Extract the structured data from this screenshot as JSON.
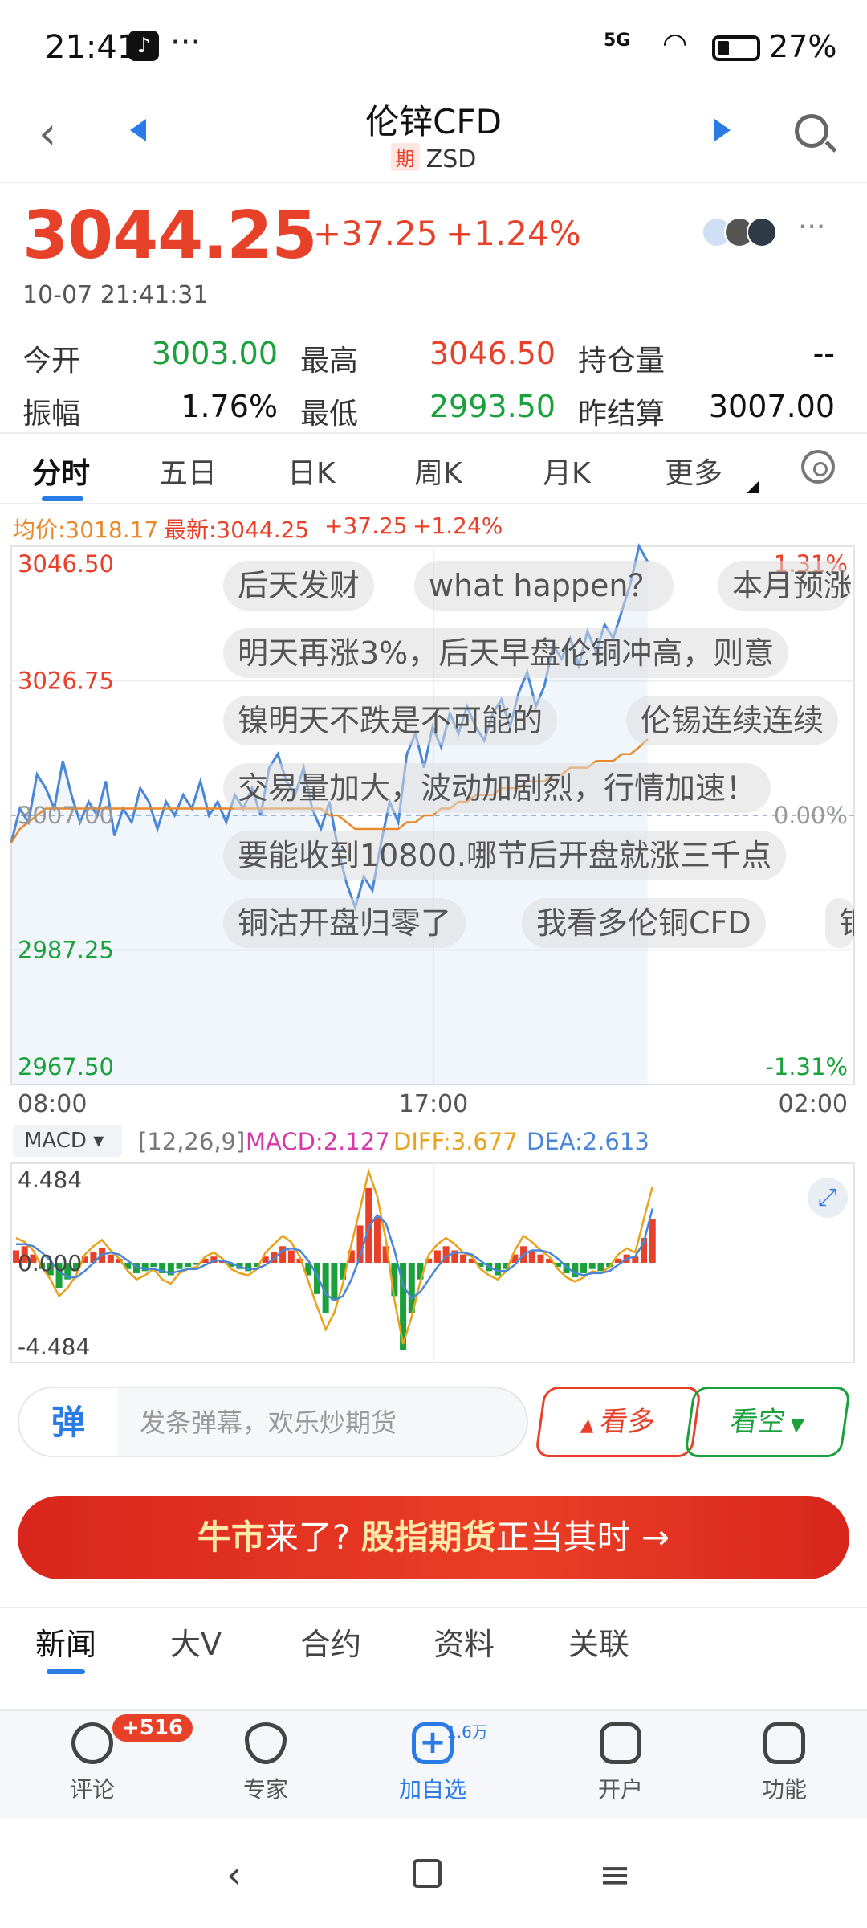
{
  "status_bar": {
    "time": "21:41",
    "more": "···",
    "signal": "5G",
    "battery": "27%"
  },
  "header": {
    "title": "伦锌CFD",
    "tag": "期",
    "code": "ZSD"
  },
  "quote": {
    "price": "3044.25",
    "change": "+37.25",
    "change_pct": "+1.24%",
    "timestamp": "10-07 21:41:31",
    "stats": [
      {
        "label": "今开",
        "value": "3003.00",
        "color": "green"
      },
      {
        "label": "最高",
        "value": "3046.50",
        "color": "red"
      },
      {
        "label": "持仓量",
        "value": "--",
        "color": "black"
      },
      {
        "label": "振幅",
        "value": "1.76%",
        "color": "black"
      },
      {
        "label": "最低",
        "value": "2993.50",
        "color": "green"
      },
      {
        "label": "昨结算",
        "value": "3007.00",
        "color": "black"
      }
    ]
  },
  "period_tabs": [
    "分时",
    "五日",
    "日K",
    "周K",
    "月K",
    "更多"
  ],
  "chart_info": {
    "avg": "均价:3018.17",
    "latest": "最新:3044.25",
    "chg": "+37.25",
    "chg_pct": "+1.24%"
  },
  "chart_data": {
    "type": "line",
    "ylim": [
      2967.5,
      3046.5
    ],
    "y_ticks_left": [
      "3046.50",
      "3026.75",
      "3007.00",
      "2987.25",
      "2967.50"
    ],
    "y_ticks_right": [
      "1.31%",
      "0.00%",
      "-1.31%"
    ],
    "x_ticks": [
      "08:00",
      "17:00",
      "02:00"
    ],
    "baseline": 3007.0,
    "series": [
      {
        "name": "最新",
        "color": "#4a86d8",
        "values": [
          3003,
          3008,
          3006,
          3013,
          3011,
          3008,
          3015,
          3010,
          3006,
          3009,
          3007,
          3012,
          3004,
          3008,
          3006,
          3011,
          3009,
          3005,
          3009,
          3007,
          3010,
          3008,
          3012,
          3007,
          3009,
          3006,
          3010,
          3008,
          3011,
          3007,
          3014,
          3016,
          3012,
          3010,
          3014,
          3008,
          3005,
          3009,
          3002,
          2997,
          2993.5,
          2998,
          2996,
          3003,
          3009,
          3006,
          3016,
          3019,
          3014,
          3020,
          3017,
          3022,
          3019,
          3023,
          3020,
          3018,
          3022,
          3024,
          3020,
          3025,
          3028,
          3023,
          3026,
          3032,
          3030,
          3033,
          3029,
          3034,
          3031,
          3035,
          3033,
          3037,
          3041,
          3046.5,
          3044.25
        ]
      },
      {
        "name": "均价",
        "color": "#e88a2c",
        "values": [
          3003,
          3005,
          3006,
          3007,
          3008,
          3008,
          3008,
          3008,
          3008,
          3008,
          3008,
          3008,
          3008,
          3008,
          3008,
          3008,
          3008,
          3008,
          3008,
          3008,
          3008,
          3008,
          3008,
          3008,
          3008,
          3008,
          3008,
          3008,
          3008,
          3008,
          3008,
          3008,
          3008,
          3008,
          3008,
          3008,
          3008,
          3007,
          3007,
          3006,
          3005,
          3005,
          3005,
          3005,
          3005,
          3005,
          3006,
          3006,
          3007,
          3007,
          3008,
          3008,
          3009,
          3009,
          3010,
          3010,
          3010,
          3011,
          3011,
          3011,
          3012,
          3012,
          3012,
          3013,
          3013,
          3014,
          3014,
          3014,
          3015,
          3015,
          3015,
          3016,
          3016,
          3017,
          3018.17
        ]
      }
    ]
  },
  "danmaku": [
    "后天发财",
    "what happen？",
    "本月预涨",
    "明天再涨3%，后天早盘伦铜冲高，则意",
    "镍明天不跌是不可能的",
    "伦锡连续连续",
    "交易量加大，波动加剧烈，行情加速！",
    "要能收到10800.哪节后开盘就涨三千点",
    "铜沽开盘归零了",
    "我看多伦铜CFD",
    "铜"
  ],
  "macd": {
    "selector": "MACD",
    "params": "[12,26,9]",
    "macd": "MACD:2.127",
    "diff": "DIFF:3.677",
    "dea": "DEA:2.613",
    "y_ticks": [
      "4.484",
      "0.000",
      "-4.484"
    ],
    "hist": [
      0.6,
      0.8,
      0.4,
      -0.3,
      -0.6,
      -1.2,
      -0.8,
      -0.4,
      0.3,
      0.5,
      0.7,
      0.4,
      0.2,
      -0.3,
      -0.5,
      -0.4,
      -0.2,
      -0.5,
      -0.6,
      -0.3,
      -0.2,
      -0.1,
      0.2,
      0.3,
      0.1,
      -0.2,
      -0.3,
      -0.4,
      -0.2,
      0.3,
      0.5,
      0.8,
      0.6,
      0.2,
      -0.6,
      -1.5,
      -2.4,
      -1.8,
      -0.8,
      0.6,
      1.8,
      3.6,
      2.2,
      0.8,
      -1.6,
      -4.2,
      -2.4,
      -0.8,
      0.2,
      0.6,
      0.8,
      0.6,
      0.4,
      0.2,
      -0.2,
      -0.4,
      -0.6,
      -0.3,
      0.4,
      0.8,
      0.6,
      0.4,
      0.2,
      -0.2,
      -0.5,
      -0.7,
      -0.5,
      -0.3,
      -0.4,
      -0.2,
      0.2,
      0.4,
      0.3,
      1.2,
      2.1
    ],
    "diff_line": [
      1.2,
      1.0,
      0.6,
      -0.2,
      -0.8,
      -1.6,
      -1.2,
      -0.6,
      0.4,
      0.8,
      1.1,
      0.6,
      0.2,
      -0.4,
      -0.8,
      -0.6,
      -0.3,
      -0.8,
      -1.0,
      -0.5,
      -0.3,
      -0.2,
      0.3,
      0.5,
      0.2,
      -0.3,
      -0.5,
      -0.6,
      -0.3,
      0.5,
      0.9,
      1.3,
      1.0,
      0.3,
      -0.9,
      -2.1,
      -3.2,
      -2.4,
      -1.0,
      0.9,
      2.6,
      4.4,
      3.2,
      1.1,
      -1.8,
      -3.9,
      -2.6,
      -0.9,
      0.4,
      0.9,
      1.2,
      0.9,
      0.5,
      0.3,
      -0.3,
      -0.6,
      -0.8,
      -0.4,
      0.6,
      1.3,
      1.0,
      0.6,
      0.3,
      -0.3,
      -0.7,
      -0.9,
      -0.7,
      -0.4,
      -0.5,
      -0.2,
      0.4,
      0.7,
      0.5,
      2.1,
      3.677
    ],
    "dea_line": [
      0.9,
      0.9,
      0.8,
      0.5,
      0.1,
      -0.4,
      -0.7,
      -0.7,
      -0.4,
      0.0,
      0.4,
      0.5,
      0.4,
      0.1,
      -0.2,
      -0.3,
      -0.3,
      -0.4,
      -0.5,
      -0.4,
      -0.3,
      -0.3,
      -0.1,
      0.1,
      0.1,
      0.0,
      -0.2,
      -0.3,
      -0.3,
      -0.1,
      0.2,
      0.6,
      0.7,
      0.6,
      0.1,
      -0.6,
      -1.5,
      -1.8,
      -1.6,
      -0.8,
      0.3,
      1.7,
      2.3,
      1.9,
      0.6,
      -1.1,
      -1.7,
      -1.4,
      -0.8,
      -0.2,
      0.3,
      0.5,
      0.5,
      0.4,
      0.1,
      -0.2,
      -0.4,
      -0.4,
      -0.1,
      0.4,
      0.6,
      0.6,
      0.5,
      0.2,
      -0.2,
      -0.5,
      -0.6,
      -0.5,
      -0.5,
      -0.4,
      -0.1,
      0.2,
      0.3,
      1.0,
      2.613
    ]
  },
  "comment_bar": {
    "danmaku_icon": "弹",
    "placeholder": "发条弹幕，欢乐炒期货",
    "bull": "看多",
    "bear": "看空"
  },
  "banner": {
    "part1": "牛市",
    "part2": "来了? ",
    "part3": "股指期货",
    "part4": "正当其时",
    "arrow": "→"
  },
  "news_tabs": [
    "新闻",
    "大V",
    "合约",
    "资料",
    "关联"
  ],
  "bottom_nav": [
    {
      "label": "评论",
      "badge": "+516"
    },
    {
      "label": "专家"
    },
    {
      "label": "加自选",
      "badge": "1.6万"
    },
    {
      "label": "开户"
    },
    {
      "label": "功能"
    }
  ],
  "colors": {
    "up": "#e8412a",
    "down": "#1aa13b",
    "accent": "#2b7be6"
  }
}
